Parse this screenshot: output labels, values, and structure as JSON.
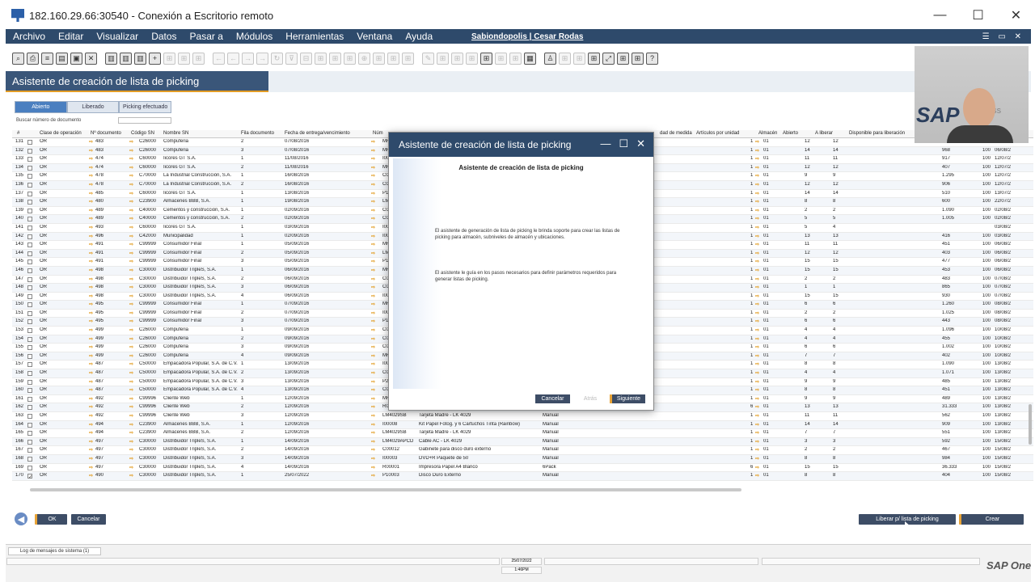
{
  "window": {
    "title": "182.160.29.66:30540 - Conexión a Escritorio remoto",
    "controls": [
      "—",
      "☐",
      "✕"
    ]
  },
  "menu": {
    "items": [
      "Archivo",
      "Editar",
      "Visualizar",
      "Datos",
      "Pasar a",
      "Módulos",
      "Herramientas",
      "Ventana",
      "Ayuda"
    ],
    "session": "Sabiondopolis | Cesar Rodas",
    "right_icons": "☰ ▭ ✕"
  },
  "panel": {
    "title": "Asistente de creación de lista de picking"
  },
  "tabs": [
    "Abierto",
    "Liberado",
    "Picking efectuado"
  ],
  "search": {
    "label": "Buscar número de documento",
    "value": ""
  },
  "grid": {
    "headers": [
      "#",
      "Clase de operación",
      "Nº documento",
      "Código SN",
      "Nombre SN",
      "Fila documento",
      "Fecha de entrega/vencimiento",
      "Núm",
      "dad de medida",
      "Artículos por unidad",
      "Almacén",
      "Abierto",
      "A liberar",
      "Disponible para liberación"
    ],
    "rows": [
      [
        "131",
        "OR",
        "483",
        "C26000",
        "Compuferia",
        "2",
        "07/08/2016",
        "MR",
        "",
        "",
        "1",
        "01",
        "12",
        "12",
        "461",
        "100",
        "06/08/2"
      ],
      [
        "132",
        "OR",
        "483",
        "C26000",
        "Compuferia",
        "3",
        "07/08/2016",
        "MR",
        "",
        "",
        "1",
        "01",
        "14",
        "14",
        "968",
        "100",
        "06/08/2"
      ],
      [
        "133",
        "OR",
        "474",
        "C60000",
        "Iicores GT S.A.",
        "1",
        "11/08/2016",
        "I00",
        "",
        "",
        "1",
        "01",
        "11",
        "11",
        "917",
        "100",
        "12/07/2"
      ],
      [
        "134",
        "OR",
        "474",
        "C60000",
        "Iicores GT S.A.",
        "2",
        "11/08/2016",
        "MR",
        "",
        "",
        "1",
        "01",
        "12",
        "12",
        "407",
        "100",
        "12/07/2"
      ],
      [
        "135",
        "OR",
        "478",
        "C70000",
        "La Industrial Construcción, S.A.",
        "1",
        "16/08/2016",
        "C00",
        "",
        "",
        "1",
        "01",
        "9",
        "9",
        "1.295",
        "100",
        "12/07/2"
      ],
      [
        "136",
        "OR",
        "478",
        "C70000",
        "La Industrial Construcción, S.A.",
        "2",
        "16/08/2016",
        "C00",
        "",
        "",
        "1",
        "01",
        "12",
        "12",
        "906",
        "100",
        "12/07/2"
      ],
      [
        "137",
        "OR",
        "485",
        "C60000",
        "Iicores GT S.A.",
        "1",
        "13/08/2016",
        "P10",
        "",
        "",
        "1",
        "01",
        "14",
        "14",
        "510",
        "100",
        "13/07/2"
      ],
      [
        "138",
        "OR",
        "480",
        "C23900",
        "Almacenes BBB, S.A.",
        "1",
        "19/08/2016",
        "LM",
        "",
        "",
        "1",
        "01",
        "8",
        "8",
        "600",
        "100",
        "22/07/2"
      ],
      [
        "139",
        "OR",
        "489",
        "C40000",
        "Cementos y construcción, S.A.",
        "1",
        "02/09/2016",
        "C00",
        "",
        "",
        "1",
        "01",
        "2",
        "2",
        "1.090",
        "100",
        "02/08/2"
      ],
      [
        "140",
        "OR",
        "489",
        "C40000",
        "Cementos y construcción, S.A.",
        "2",
        "02/09/2016",
        "C00",
        "",
        "",
        "1",
        "01",
        "5",
        "5",
        "1.005",
        "100",
        "02/08/2"
      ],
      [
        "141",
        "OR",
        "493",
        "C60000",
        "Iicores GT S.A.",
        "1",
        "03/09/2016",
        "I00",
        "",
        "",
        "1",
        "01",
        "5",
        "4",
        "",
        "",
        "03/08/2"
      ],
      [
        "142",
        "OR",
        "496",
        "C42000",
        "Municipalidad",
        "1",
        "02/09/2016",
        "I00",
        "",
        "",
        "1",
        "01",
        "13",
        "13",
        "416",
        "100",
        "03/08/2"
      ],
      [
        "143",
        "OR",
        "491",
        "C99999",
        "Consumidor Final",
        "1",
        "05/09/2016",
        "MR",
        "",
        "",
        "1",
        "01",
        "11",
        "11",
        "451",
        "100",
        "06/08/2"
      ],
      [
        "144",
        "OR",
        "491",
        "C99999",
        "Consumidor Final",
        "2",
        "05/09/2016",
        "LM",
        "",
        "",
        "1",
        "01",
        "12",
        "12",
        "403",
        "100",
        "06/08/2"
      ],
      [
        "145",
        "OR",
        "491",
        "C99999",
        "Consumidor Final",
        "3",
        "05/09/2016",
        "P10",
        "",
        "",
        "1",
        "01",
        "15",
        "15",
        "477",
        "100",
        "06/08/2"
      ],
      [
        "146",
        "OR",
        "498",
        "C30000",
        "Distribuidor TripleS, S.A.",
        "1",
        "06/09/2016",
        "MR",
        "",
        "",
        "1",
        "01",
        "15",
        "15",
        "453",
        "100",
        "06/08/2"
      ],
      [
        "147",
        "OR",
        "498",
        "C30000",
        "Distribuidor TripleS, S.A.",
        "2",
        "06/09/2016",
        "C00",
        "",
        "",
        "1",
        "01",
        "2",
        "2",
        "483",
        "100",
        "07/08/2"
      ],
      [
        "148",
        "OR",
        "498",
        "C30000",
        "Distribuidor TripleS, S.A.",
        "3",
        "06/09/2016",
        "C00",
        "",
        "",
        "1",
        "01",
        "1",
        "1",
        "865",
        "100",
        "07/08/2"
      ],
      [
        "149",
        "OR",
        "498",
        "C30000",
        "Distribuidor TripleS, S.A.",
        "4",
        "06/09/2016",
        "I00",
        "",
        "",
        "1",
        "01",
        "15",
        "15",
        "930",
        "100",
        "07/08/2"
      ],
      [
        "150",
        "OR",
        "495",
        "C99999",
        "Consumidor Final",
        "1",
        "07/09/2016",
        "MR",
        "",
        "",
        "1",
        "01",
        "6",
        "6",
        "1.260",
        "100",
        "08/08/2"
      ],
      [
        "151",
        "OR",
        "495",
        "C99999",
        "Consumidor Final",
        "2",
        "07/09/2016",
        "I00",
        "",
        "",
        "1",
        "01",
        "2",
        "2",
        "1.025",
        "100",
        "08/08/2"
      ],
      [
        "152",
        "OR",
        "495",
        "C99999",
        "Consumidor Final",
        "3",
        "07/09/2016",
        "P10",
        "",
        "",
        "1",
        "01",
        "6",
        "6",
        "443",
        "100",
        "08/08/2"
      ],
      [
        "153",
        "OR",
        "499",
        "C26000",
        "Compuferia",
        "1",
        "09/09/2016",
        "C00",
        "",
        "",
        "1",
        "01",
        "4",
        "4",
        "1.096",
        "100",
        "10/08/2"
      ],
      [
        "154",
        "OR",
        "499",
        "C26000",
        "Compuferia",
        "2",
        "09/09/2016",
        "C00",
        "",
        "",
        "1",
        "01",
        "4",
        "4",
        "455",
        "100",
        "10/08/2"
      ],
      [
        "155",
        "OR",
        "499",
        "C26000",
        "Compuferia",
        "3",
        "09/09/2016",
        "C00",
        "",
        "",
        "1",
        "01",
        "6",
        "6",
        "1.002",
        "100",
        "10/08/2"
      ],
      [
        "156",
        "OR",
        "499",
        "C26000",
        "Compuferia",
        "4",
        "09/09/2016",
        "MR",
        "",
        "",
        "1",
        "01",
        "7",
        "7",
        "402",
        "100",
        "10/08/2"
      ],
      [
        "157",
        "OR",
        "487",
        "C50000",
        "Empacadora Popular, S.A. de C.V.",
        "1",
        "13/09/2016",
        "I00",
        "",
        "",
        "1",
        "01",
        "8",
        "8",
        "1.090",
        "100",
        "13/08/2"
      ],
      [
        "158",
        "OR",
        "487",
        "C50000",
        "Empacadora Popular, S.A. de C.V.",
        "2",
        "13/09/2016",
        "C00",
        "",
        "",
        "1",
        "01",
        "4",
        "4",
        "1.071",
        "100",
        "13/08/2"
      ],
      [
        "159",
        "OR",
        "487",
        "C50000",
        "Empacadora Popular, S.A. de C.V.",
        "3",
        "13/09/2016",
        "P20",
        "",
        "",
        "1",
        "01",
        "9",
        "9",
        "485",
        "100",
        "13/08/2"
      ],
      [
        "160",
        "OR",
        "487",
        "C50000",
        "Empacadora Popular, S.A. de C.V.",
        "4",
        "13/09/2016",
        "C00",
        "",
        "",
        "1",
        "01",
        "8",
        "8",
        "451",
        "100",
        "13/08/2"
      ],
      [
        "161",
        "OR",
        "492",
        "C99996",
        "Cliente Web",
        "1",
        "12/09/2016",
        "MR",
        "",
        "",
        "1",
        "01",
        "9",
        "9",
        "489",
        "100",
        "13/08/2"
      ],
      [
        "162",
        "OR",
        "492",
        "C99996",
        "Cliente Web",
        "2",
        "12/09/2016",
        "R0000",
        "Impresora Papel A4 Blanco",
        "6 Paquetes",
        "6",
        "01",
        "13",
        "13",
        "31.333",
        "100",
        "13/08/2"
      ],
      [
        "163",
        "OR",
        "492",
        "C99996",
        "Cliente Web",
        "3",
        "12/09/2016",
        "LM4029SB",
        "Tarjeta Madre - LK 4029",
        "Manual",
        "1",
        "01",
        "11",
        "11",
        "562",
        "100",
        "13/08/2"
      ],
      [
        "164",
        "OR",
        "494",
        "C23900",
        "Almacenes BBB, S.A.",
        "1",
        "12/09/2016",
        "I00008",
        "Kit Papel Fotog. y 6 Cartuchos Tinta (Rainbow)",
        "Manual",
        "1",
        "01",
        "14",
        "14",
        "909",
        "100",
        "13/08/2"
      ],
      [
        "165",
        "OR",
        "494",
        "C23900",
        "Almacenes BBB, S.A.",
        "2",
        "12/09/2016",
        "LM4029SB",
        "Tarjeta Madre - LK 4029",
        "Manual",
        "1",
        "01",
        "7",
        "7",
        "551",
        "100",
        "13/08/2"
      ],
      [
        "166",
        "OR",
        "497",
        "C30000",
        "Distribuidor TripleS, S.A.",
        "1",
        "14/09/2016",
        "LM4029APCD",
        "Cable AC - LK 4029",
        "Manual",
        "1",
        "01",
        "3",
        "3",
        "592",
        "100",
        "15/08/2"
      ],
      [
        "167",
        "OR",
        "497",
        "C30000",
        "Distribuidor TripleS, S.A.",
        "2",
        "14/09/2016",
        "C00012",
        "Gabinete para disco duro externo",
        "Manual",
        "1",
        "01",
        "2",
        "2",
        "467",
        "100",
        "15/08/2"
      ],
      [
        "168",
        "OR",
        "497",
        "C30000",
        "Distribuidor TripleS, S.A.",
        "3",
        "14/09/2016",
        "I00003",
        "DVD+R Paquete de 50",
        "Manual",
        "1",
        "01",
        "8",
        "8",
        "984",
        "100",
        "15/08/2"
      ],
      [
        "169",
        "OR",
        "497",
        "C30000",
        "Distribuidor TripleS, S.A.",
        "4",
        "14/09/2016",
        "R00001",
        "Impresora Papel A4 Blanco",
        "6Pack",
        "6 Paquetes",
        "6",
        "01",
        "15",
        "15",
        "36.333",
        "100",
        "15/08/2"
      ],
      [
        "170",
        "OR",
        "490",
        "C30000",
        "Distribuidor TripleS, S.A.",
        "1",
        "25/07/2022",
        "P10003",
        "Disco Duro Externo",
        "Manual",
        "1",
        "01",
        "8",
        "8",
        "404",
        "100",
        "15/08/2"
      ]
    ]
  },
  "buttons": {
    "ok": "OK",
    "cancel": "Cancelar",
    "release": "Liberar p/ lista de picking",
    "create": "Crear"
  },
  "status": {
    "log": "Log de mensajes de sistema (1)",
    "date": "25/07/2022",
    "time": "1:46PM",
    "brand": "SAP One"
  },
  "webcam": {
    "brand": "SAP",
    "suffix": "ess"
  },
  "dialog": {
    "title": "Asistente de creación de lista de picking",
    "heading": "Asistente de creación de lista de picking",
    "p1": "El asistente de generación de lista de picking le brinda soporte para crear las listas de picking para almacén, subniveles de almacén y ubicaciones.",
    "p2": "El asistente le guía en los pasos necesarios para definir parámetros requeridos para generar listas de picking.",
    "cancel": "Cancelar",
    "back": "Atrás",
    "next": "Siguiente",
    "controls": [
      "—",
      "☐",
      "✕"
    ]
  }
}
